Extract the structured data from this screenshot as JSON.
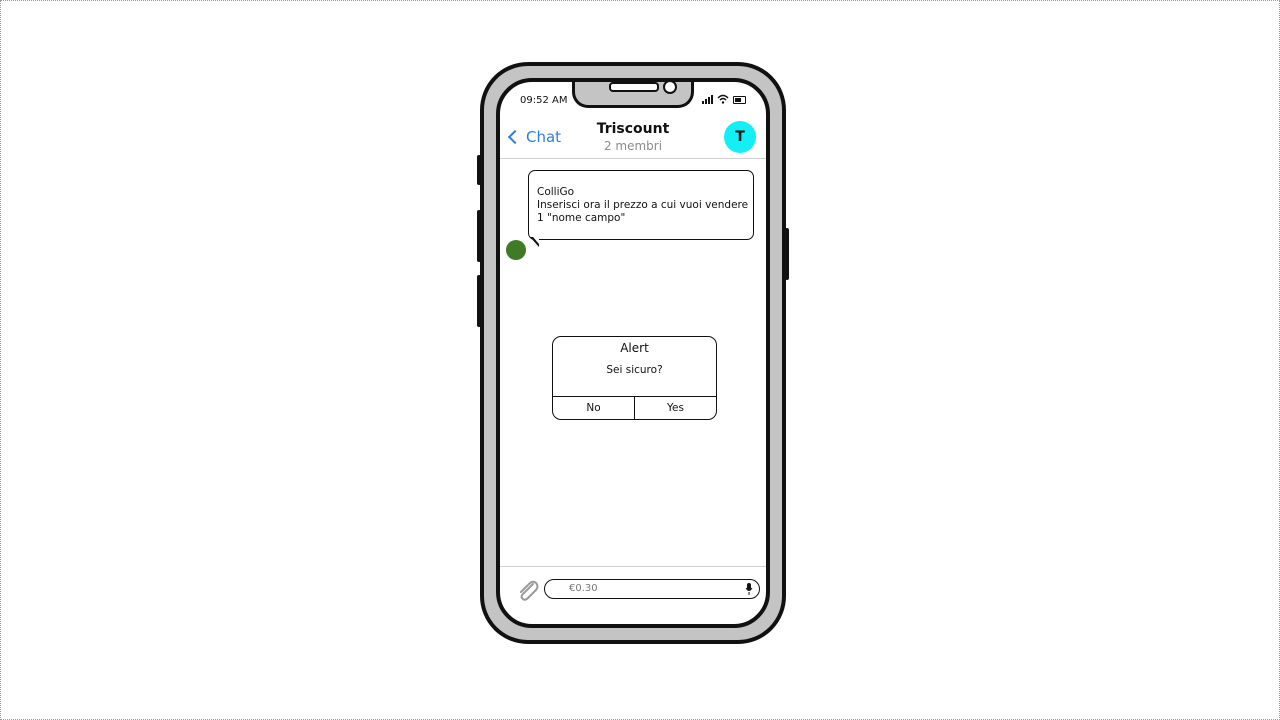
{
  "status_bar": {
    "time": "09:52 AM"
  },
  "nav": {
    "back_label": "Chat",
    "title": "Triscount",
    "subtitle": "2 membri",
    "avatar_letter": "T"
  },
  "message": {
    "lines": [
      "ColliGo",
      "Inserisci ora il prezzo a cui vuoi vendere",
      "1 \"nome campo\""
    ]
  },
  "alert": {
    "title": "Alert",
    "message": "Sei sicuro?",
    "no_label": "No",
    "yes_label": "Yes"
  },
  "composer": {
    "value": "€0.30"
  },
  "colors": {
    "accent": "#2f7fd9",
    "avatar": "#12f0f5",
    "sender_dot": "#3f7a26",
    "phone_body": "#c4c4c4"
  },
  "icons": [
    "back-chevron-icon",
    "signal-icon",
    "wifi-icon",
    "battery-icon",
    "paperclip-icon",
    "microphone-icon"
  ]
}
